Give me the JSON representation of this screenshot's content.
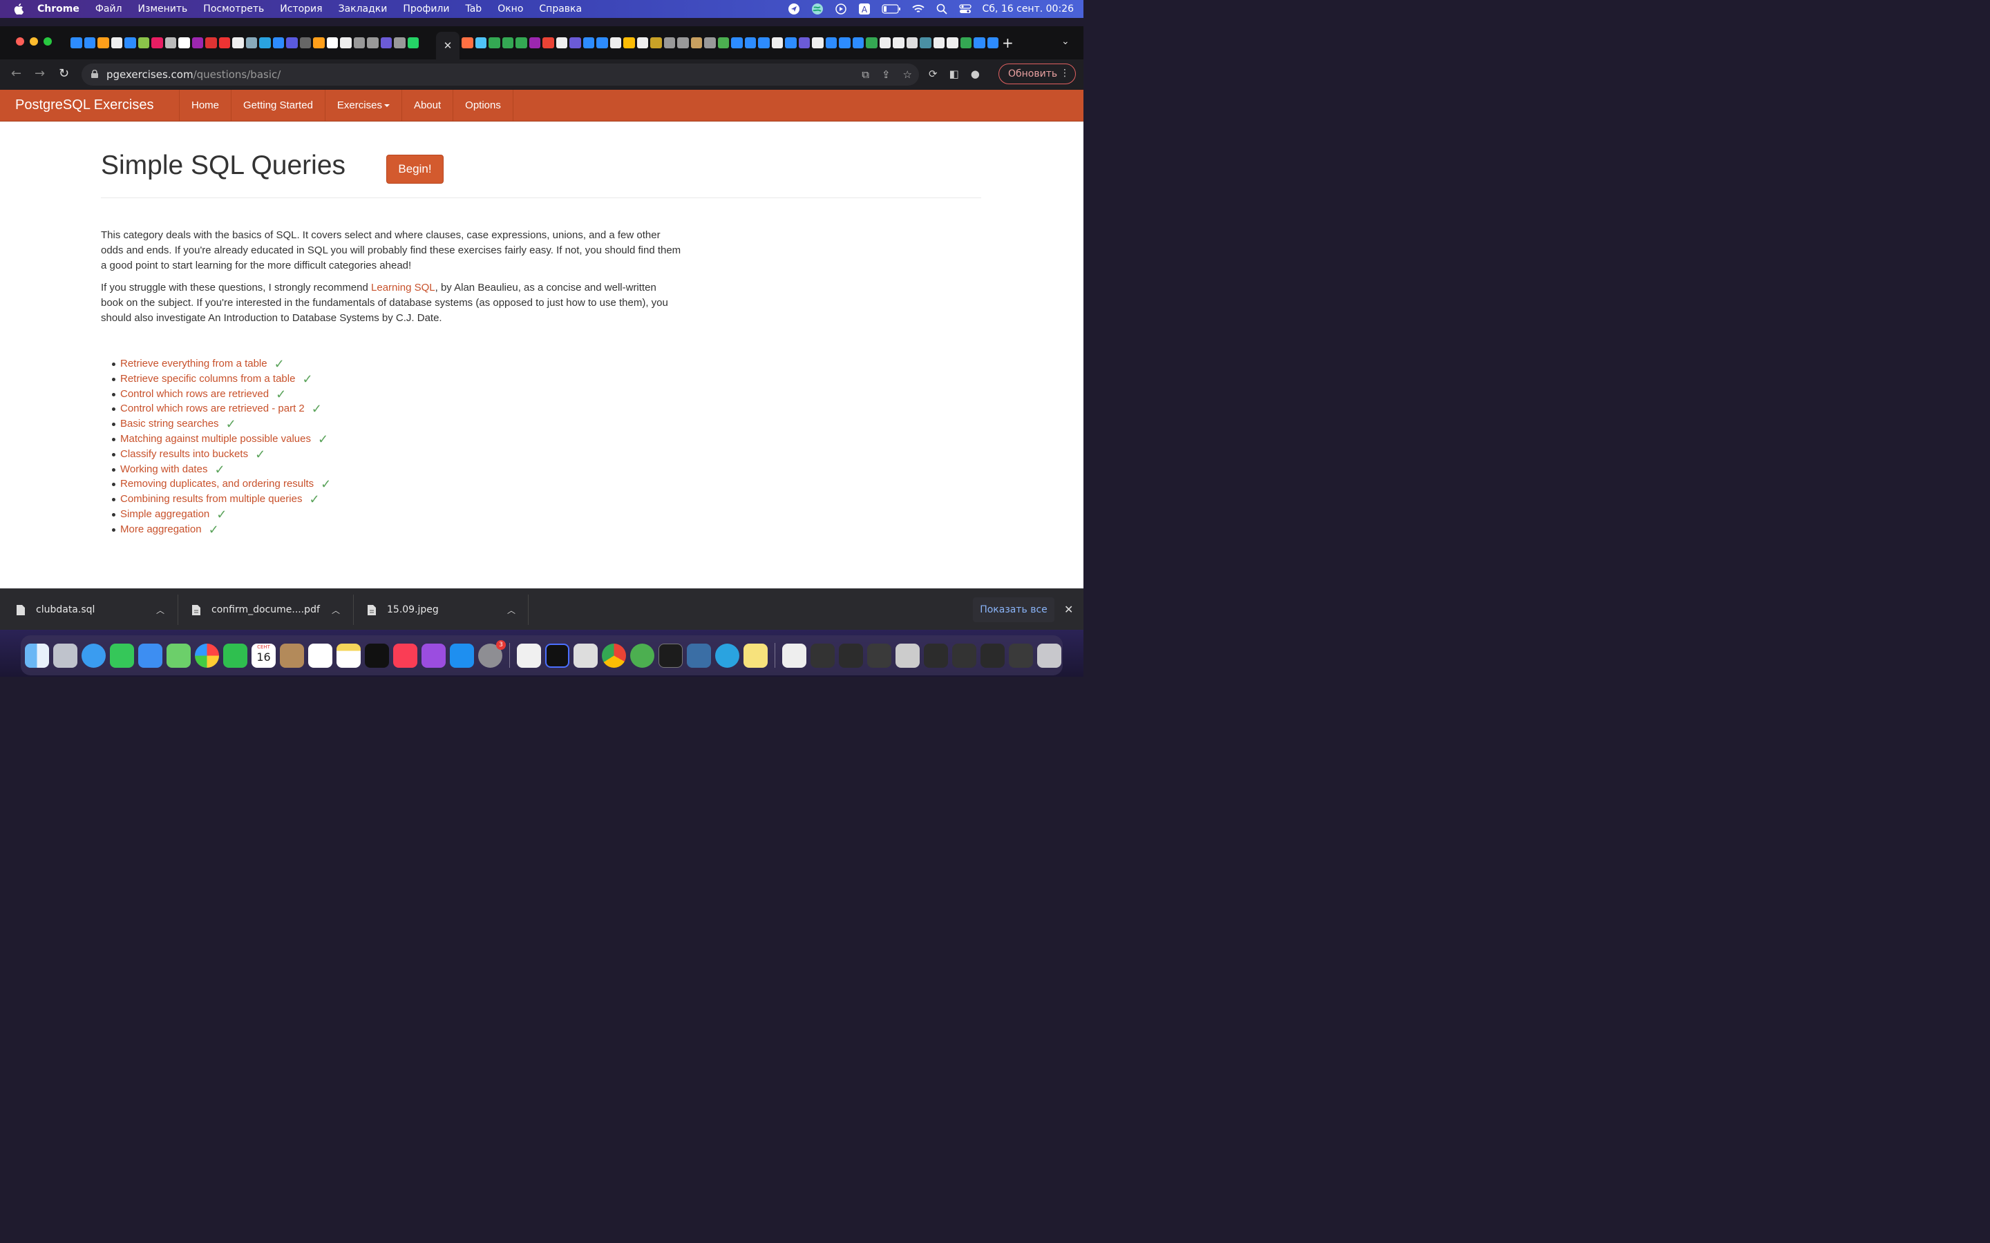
{
  "menubar": {
    "app": "Chrome",
    "items": [
      "Файл",
      "Изменить",
      "Посмотреть",
      "История",
      "Закладки",
      "Профили",
      "Tab",
      "Окно",
      "Справка"
    ],
    "clock": "Сб, 16 сент.  00:26",
    "icons": [
      "location-icon",
      "globe-icon",
      "play-icon",
      "input-source-icon",
      "battery-icon",
      "wifi-icon",
      "search-icon",
      "control-center-icon"
    ]
  },
  "browser": {
    "url_domain": "pgexercises.com",
    "url_path": "/questions/basic/",
    "update_label": "Обновить",
    "accent": "#c8512b"
  },
  "site": {
    "brand": "PostgreSQL Exercises",
    "nav": [
      "Home",
      "Getting Started",
      "Exercises",
      "About",
      "Options"
    ]
  },
  "main": {
    "title": "Simple SQL Queries",
    "begin_label": "Begin!",
    "intro": "This category deals with the basics of SQL. It covers select and where clauses, case expressions, unions, and a few other odds and ends. If you're already educated in SQL you will probably find these exercises fairly easy. If not, you should find them a good point to start learning for the more difficult categories ahead!",
    "p2_before": "If you struggle with these questions, I strongly recommend ",
    "p2_link": "Learning SQL",
    "p2_after": ", by Alan Beaulieu, as a concise and well-written book on the subject. If you're interested in the fundamentals of database systems (as opposed to just how to use them), you should also investigate An Introduction to Database Systems by C.J. Date.",
    "exercises": [
      "Retrieve everything from a table",
      "Retrieve specific columns from a table",
      "Control which rows are retrieved",
      "Control which rows are retrieved - part 2",
      "Basic string searches",
      "Matching against multiple possible values",
      "Classify results into buckets",
      "Working with dates",
      "Removing duplicates, and ordering results",
      "Combining results from multiple queries",
      "Simple aggregation",
      "More aggregation"
    ],
    "check_symbol": "✓"
  },
  "downloads": {
    "files": [
      "clubdata.sql",
      "confirm_docume....pdf",
      "15.09.jpeg"
    ],
    "show_all": "Показать все"
  },
  "dock": {
    "calendar_month": "СЕНТ",
    "calendar_day": "16",
    "settings_badge": "3"
  }
}
